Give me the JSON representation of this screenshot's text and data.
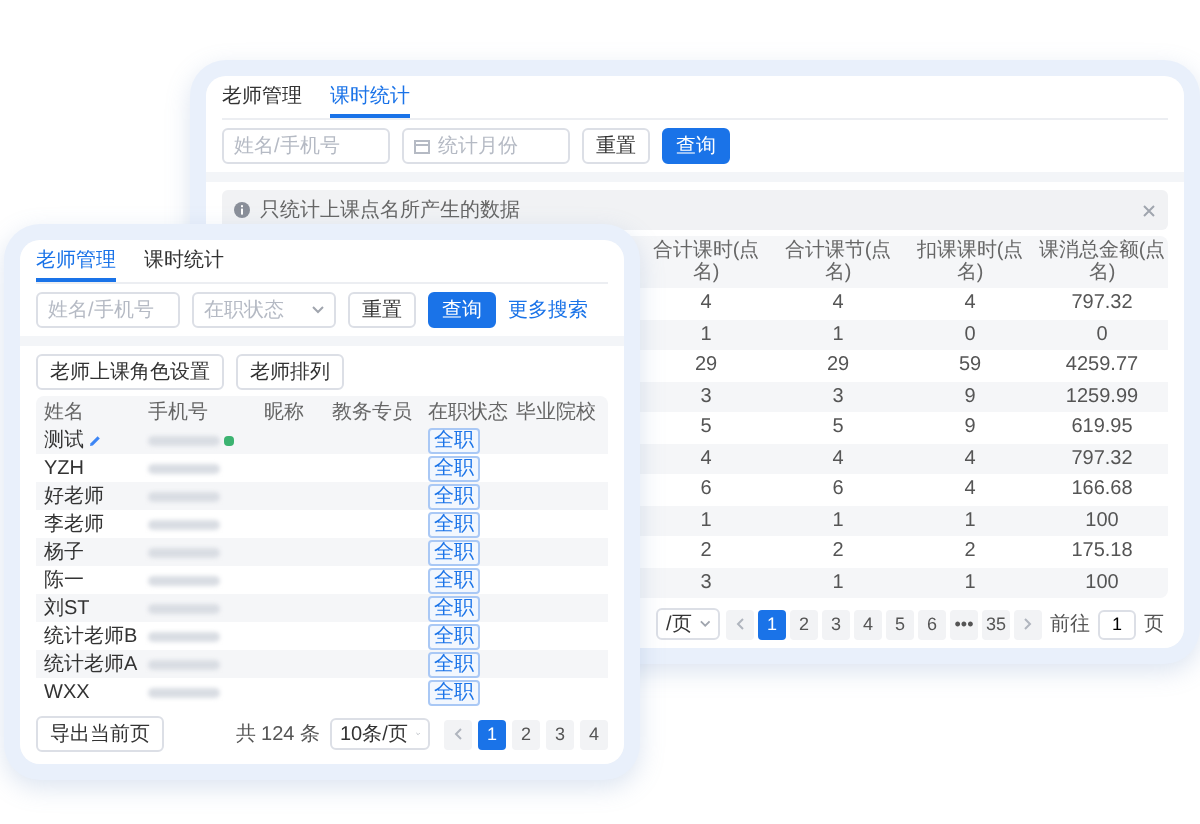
{
  "stats_window": {
    "tabs": [
      {
        "label": "老师管理",
        "selected": false
      },
      {
        "label": "课时统计",
        "selected": true
      }
    ],
    "filters": {
      "name": {
        "placeholder": "姓名/手机号"
      },
      "month": {
        "placeholder": "统计月份"
      }
    },
    "buttons": [
      {
        "label": "重置",
        "kind": "default"
      },
      {
        "label": "查询",
        "kind": "primary"
      }
    ],
    "notice": {
      "text": "只统计上课点名所产生的数据",
      "closable": true
    },
    "table": {
      "columns": [
        "合计课时(点名)",
        "合计课节(点名)",
        "扣课课时(点名)",
        "课消总金额(点名)"
      ],
      "rows": [
        [
          "4",
          "4",
          "4",
          "797.32"
        ],
        [
          "1",
          "1",
          "0",
          "0"
        ],
        [
          "29",
          "29",
          "59",
          "4259.77"
        ],
        [
          "3",
          "3",
          "9",
          "1259.99"
        ],
        [
          "5",
          "5",
          "9",
          "619.95"
        ],
        [
          "4",
          "4",
          "4",
          "797.32"
        ],
        [
          "6",
          "6",
          "4",
          "166.68"
        ],
        [
          "1",
          "1",
          "1",
          "100"
        ],
        [
          "2",
          "2",
          "2",
          "175.18"
        ],
        [
          "3",
          "1",
          "1",
          "100"
        ]
      ]
    },
    "pagination": {
      "page_size": "/页",
      "pages": [
        {
          "kind": "prev",
          "selected": false
        },
        {
          "kind": "page",
          "label": "1",
          "selected": true
        },
        {
          "kind": "page",
          "label": "2",
          "selected": false
        },
        {
          "kind": "page",
          "label": "3",
          "selected": false
        },
        {
          "kind": "page",
          "label": "4",
          "selected": false
        },
        {
          "kind": "page",
          "label": "5",
          "selected": false
        },
        {
          "kind": "page",
          "label": "6",
          "selected": false
        },
        {
          "kind": "page",
          "label": "•••",
          "selected": false
        },
        {
          "kind": "page",
          "label": "35",
          "selected": false
        },
        {
          "kind": "next",
          "selected": false
        }
      ],
      "goto_label": "前往",
      "goto_value": "1",
      "goto_suffix": "页"
    }
  },
  "teacher_window": {
    "tabs": [
      {
        "label": "老师管理",
        "selected": true
      },
      {
        "label": "课时统计",
        "selected": false
      }
    ],
    "filters": {
      "name": {
        "placeholder": "姓名/手机号"
      },
      "status": {
        "placeholder": "在职状态"
      }
    },
    "buttons": [
      {
        "label": "重置",
        "kind": "default"
      },
      {
        "label": "查询",
        "kind": "primary"
      }
    ],
    "more_link": "更多搜索",
    "actions": [
      "老师上课角色设置",
      "老师排列"
    ],
    "table": {
      "columns": [
        "姓名",
        "手机号",
        "昵称",
        "教务专员",
        "在职状态",
        "毕业院校"
      ],
      "rows": [
        {
          "name": "测试",
          "editable": true,
          "phone_badge": true,
          "status": "全职"
        },
        {
          "name": "YZH",
          "editable": false,
          "phone_badge": false,
          "status": "全职"
        },
        {
          "name": "好老师",
          "editable": false,
          "phone_badge": false,
          "status": "全职"
        },
        {
          "name": "李老师",
          "editable": false,
          "phone_badge": false,
          "status": "全职"
        },
        {
          "name": "杨子",
          "editable": false,
          "phone_badge": false,
          "status": "全职"
        },
        {
          "name": "陈一",
          "editable": false,
          "phone_badge": false,
          "status": "全职"
        },
        {
          "name": "刘ST",
          "editable": false,
          "phone_badge": false,
          "status": "全职"
        },
        {
          "name": "统计老师B",
          "editable": false,
          "phone_badge": false,
          "status": "全职"
        },
        {
          "name": "统计老师A",
          "editable": false,
          "phone_badge": false,
          "status": "全职"
        },
        {
          "name": "WXX",
          "editable": false,
          "phone_badge": false,
          "status": "全职"
        }
      ]
    },
    "footer": {
      "export": "导出当前页",
      "total": "共 124 条",
      "page_size": "10条/页",
      "pages": [
        {
          "kind": "prev",
          "selected": false
        },
        {
          "kind": "page",
          "label": "1",
          "selected": true
        },
        {
          "kind": "page",
          "label": "2",
          "selected": false
        },
        {
          "kind": "page",
          "label": "3",
          "selected": false
        },
        {
          "kind": "page",
          "label": "4",
          "selected": false
        }
      ]
    }
  }
}
